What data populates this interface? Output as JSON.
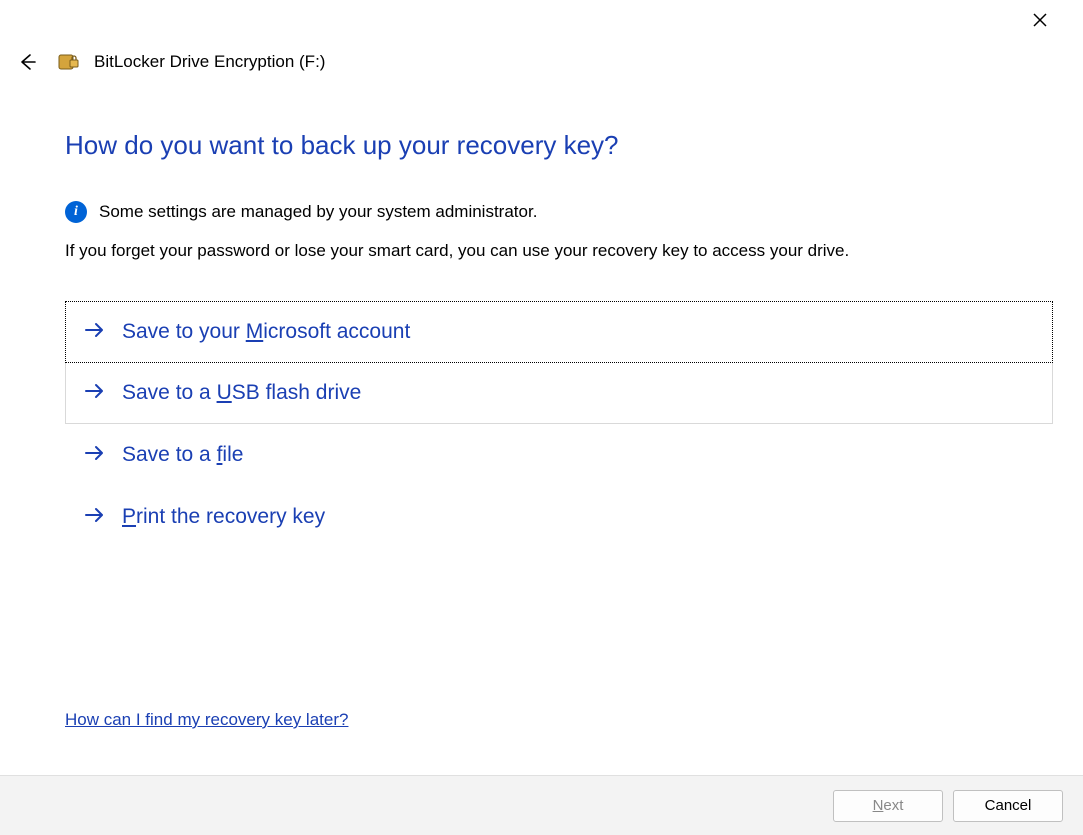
{
  "window": {
    "title": "BitLocker Drive Encryption (F:)"
  },
  "heading": "How do you want to back up your recovery key?",
  "info_text": "Some settings are managed by your system administrator.",
  "description": "If you forget your password or lose your smart card, you can use your recovery key to access your drive.",
  "options": [
    {
      "pre": "Save to your ",
      "ak": "M",
      "post": "icrosoft account",
      "focused": true,
      "bordered": false
    },
    {
      "pre": "Save to a ",
      "ak": "U",
      "post": "SB flash drive",
      "focused": false,
      "bordered": true
    },
    {
      "pre": "Save to a ",
      "ak": "f",
      "post": "ile",
      "focused": false,
      "bordered": false
    },
    {
      "pre": "",
      "ak": "P",
      "post": "rint the recovery key",
      "focused": false,
      "bordered": false
    }
  ],
  "help_link": "How can I find my recovery key later?",
  "footer": {
    "next": {
      "ak": "N",
      "post": "ext",
      "disabled": true
    },
    "cancel": "Cancel"
  }
}
